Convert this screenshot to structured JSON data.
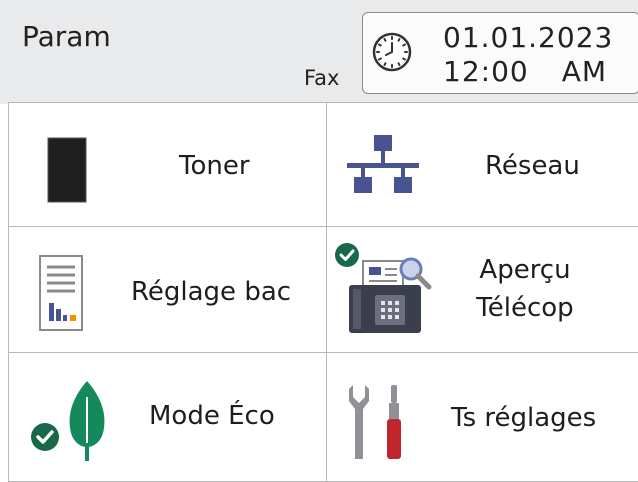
{
  "header": {
    "title": "Param",
    "mode": "Fax",
    "date": "01.01.2023",
    "time": "12:00",
    "ampm": "AM"
  },
  "tiles": [
    {
      "label": "Toner",
      "icon": "toner-cartridge-icon"
    },
    {
      "label": "Réseau",
      "icon": "network-icon"
    },
    {
      "label": "Réglage bac",
      "icon": "tray-setting-icon"
    },
    {
      "label_line1": "Aperçu",
      "label_line2": "Télécop",
      "icon": "fax-preview-icon",
      "checked": true
    },
    {
      "label": "Mode Éco",
      "icon": "eco-leaf-icon",
      "checked": true
    },
    {
      "label": "Ts réglages",
      "icon": "tools-icon"
    }
  ],
  "colors": {
    "header_bg": "#e9eaec",
    "accent_blue": "#4a5391",
    "check_green": "#17694a",
    "leaf_green": "#148a5c",
    "tool_red": "#c0262b"
  }
}
